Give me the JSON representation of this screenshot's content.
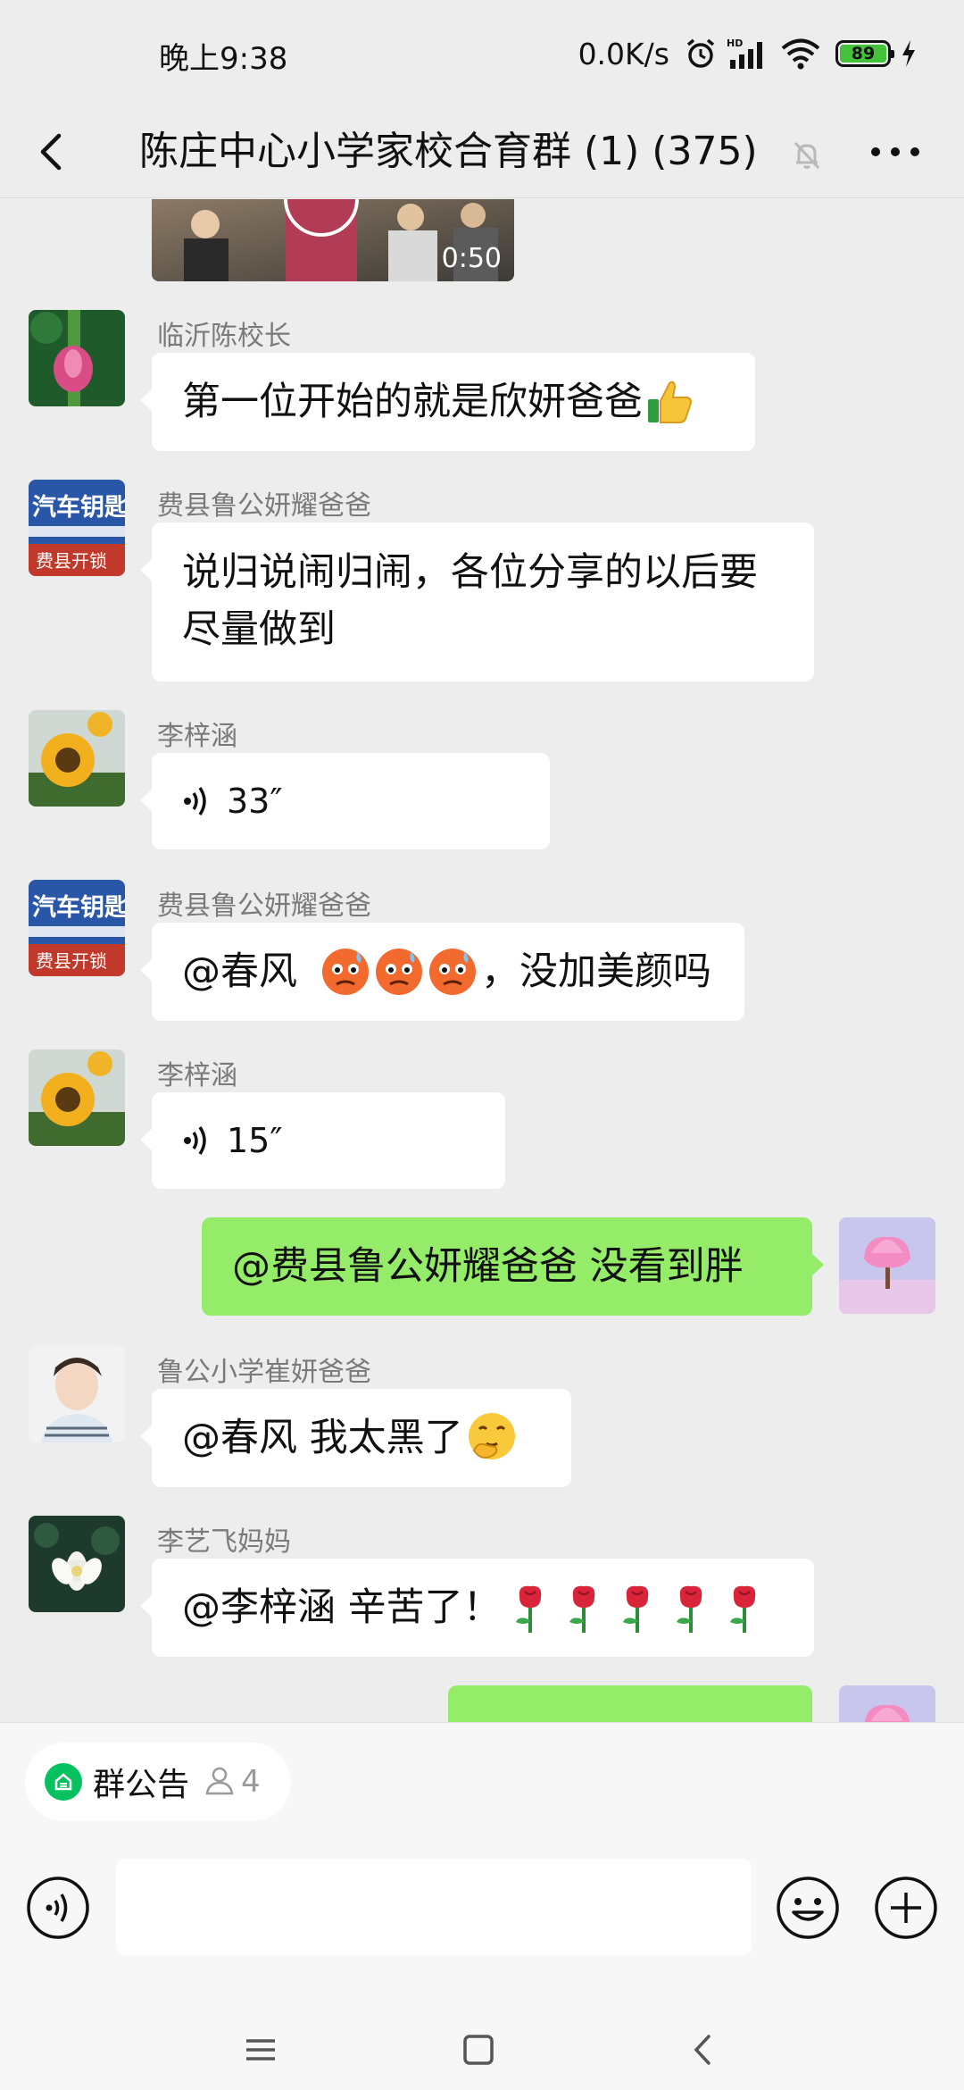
{
  "status_bar": {
    "time": "晚上9:38",
    "speed": "0.0K/s",
    "battery": "89",
    "battery_level": 0.89,
    "battery_color": "#43c23a"
  },
  "header": {
    "title": "陈庄中心小学家校合育群 (1) (375)"
  },
  "video": {
    "duration": "0:50"
  },
  "messages": [
    {
      "sender": "临沂陈校长",
      "text": "第一位开始的就是欣妍爸爸",
      "emoji": "thumbs-up-icon"
    },
    {
      "sender": "费县鲁公妍耀爸爸",
      "line1": "说归说闹归闹，各位分享的以后要",
      "line2": "尽量做到"
    },
    {
      "sender": "李梓涵",
      "duration": "33″"
    },
    {
      "sender": "费县鲁公妍耀爸爸",
      "mention": "@春风",
      "text": "，没加美颜吗",
      "emoji": "anxious-sweat-face-icon"
    },
    {
      "sender": "李梓涵",
      "duration": "15″"
    },
    {
      "text": "@费县鲁公妍耀爸爸  没看到胖"
    },
    {
      "sender": "鲁公小学崔妍爸爸",
      "text": "@春风  我太黑了",
      "emoji": "thinking-hand-face-icon"
    },
    {
      "sender": "李艺飞妈妈",
      "text": "@李梓涵  辛苦了！",
      "emoji": "rose-icon"
    }
  ],
  "bottom": {
    "notice_label": "群公告",
    "notice_count": "4",
    "input_placeholder": ""
  },
  "colors": {
    "background": "#ededed",
    "my_bubble": "#95ec69",
    "other_bubble": "#ffffff",
    "accent_green": "#07c160"
  }
}
